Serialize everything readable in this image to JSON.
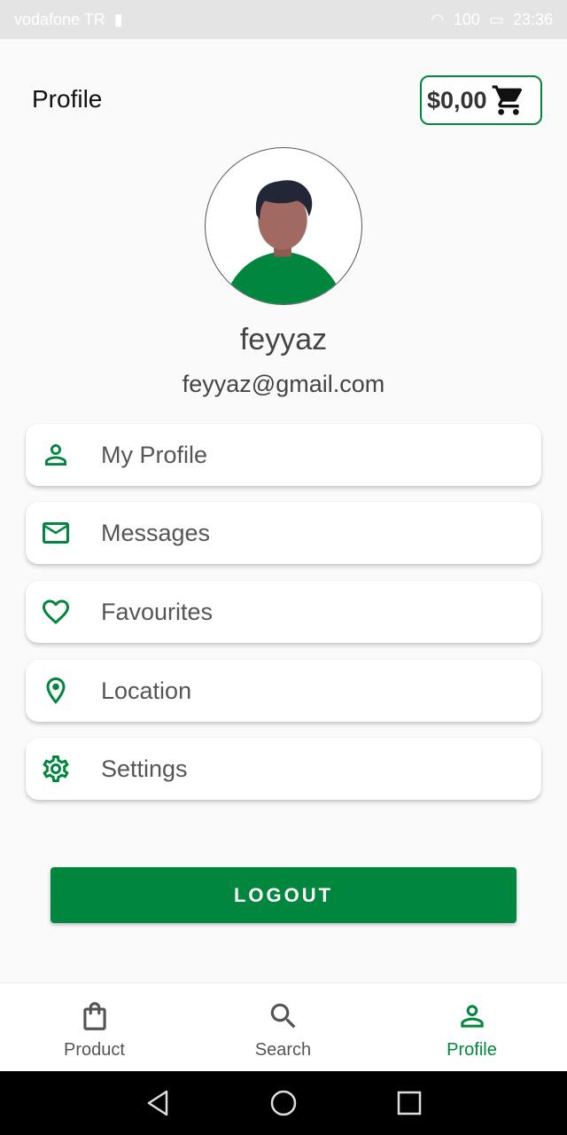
{
  "status_bar": {
    "carrier": "vodafone TR",
    "battery": "100",
    "time": "23:36"
  },
  "app_bar": {
    "title": "Profile",
    "cart_amount": "$0,00"
  },
  "profile": {
    "name": "feyyaz",
    "email": "feyyaz@gmail.com"
  },
  "menu": [
    {
      "label": "My Profile",
      "icon": "person-icon"
    },
    {
      "label": "Messages",
      "icon": "mail-icon"
    },
    {
      "label": "Favourites",
      "icon": "heart-icon"
    },
    {
      "label": "Location",
      "icon": "location-pin-icon"
    },
    {
      "label": "Settings",
      "icon": "gear-icon"
    }
  ],
  "logout_label": "LOGOUT",
  "bottom_nav": [
    {
      "label": "Product",
      "icon": "shopping-bag-icon",
      "active": false
    },
    {
      "label": "Search",
      "icon": "search-icon",
      "active": false
    },
    {
      "label": "Profile",
      "icon": "person-icon",
      "active": true
    }
  ],
  "colors": {
    "accent": "#00873d",
    "text": "#555555",
    "background": "#fafafa"
  }
}
